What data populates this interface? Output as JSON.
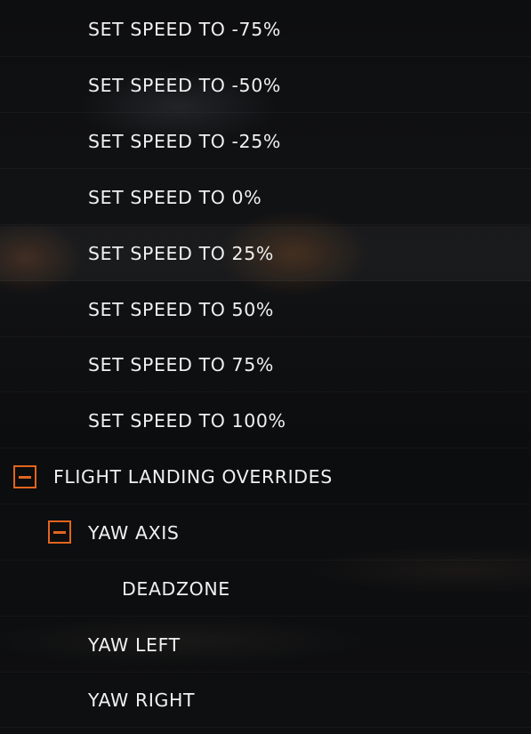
{
  "controls_list": {
    "items": [
      {
        "label": "SET SPEED TO -75%"
      },
      {
        "label": "SET SPEED TO -50%"
      },
      {
        "label": "SET SPEED TO -25%"
      },
      {
        "label": "SET SPEED TO 0%"
      },
      {
        "label": "SET SPEED TO 25%"
      },
      {
        "label": "SET SPEED TO 50%"
      },
      {
        "label": "SET SPEED TO 75%"
      },
      {
        "label": "SET SPEED TO 100%"
      },
      {
        "label": "FLIGHT LANDING OVERRIDES",
        "collapse_icon": "minus-icon"
      },
      {
        "label": "YAW AXIS",
        "collapse_icon": "minus-icon"
      },
      {
        "label": "DEADZONE"
      },
      {
        "label": "YAW LEFT"
      },
      {
        "label": "YAW RIGHT"
      }
    ]
  },
  "colors": {
    "accent": "#e3651f",
    "text": "#f0f0f0",
    "background": "#0b0c0e"
  }
}
